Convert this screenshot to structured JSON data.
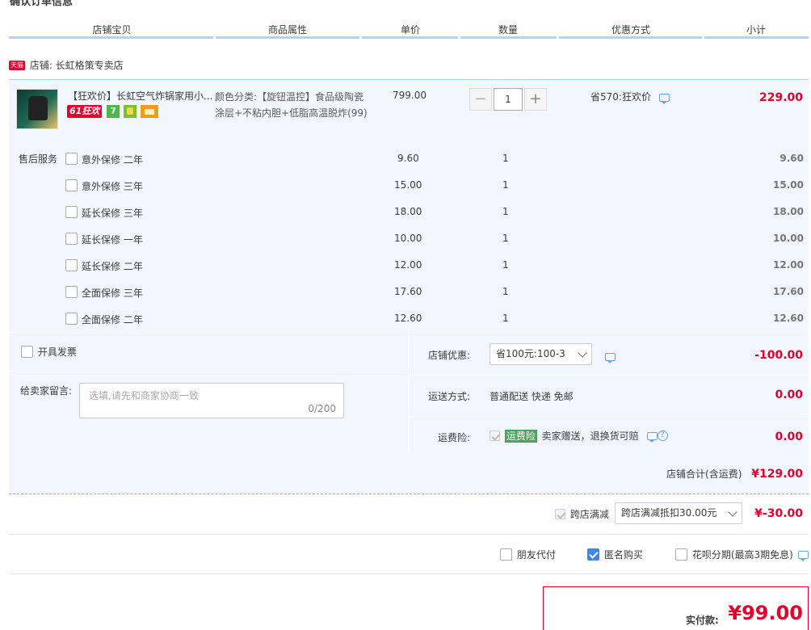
{
  "section_title": "确认订单信息",
  "columns": [
    "店铺宝贝",
    "商品属性",
    "单价",
    "数量",
    "优惠方式",
    "小计"
  ],
  "shop": {
    "badge": "天猫",
    "label": "店铺: 长虹格策专卖店"
  },
  "product": {
    "title": "【狂欢价】长虹空气炸锅家用小...",
    "promo_badge": "61狂欢",
    "attrs": "颜色分类:【旋钮温控】食品级陶瓷涂层+不粘内胆+低脂高温脱炸(99)",
    "price": "799.00",
    "qty": "1",
    "discount": "省570:狂欢价",
    "subtotal": "229.00"
  },
  "after_sales_label": "售后服务",
  "services": [
    {
      "name": "意外保修 二年",
      "price": "9.60",
      "qty": "1",
      "subtotal": "9.60"
    },
    {
      "name": "意外保修 三年",
      "price": "15.00",
      "qty": "1",
      "subtotal": "15.00"
    },
    {
      "name": "延长保修 三年",
      "price": "18.00",
      "qty": "1",
      "subtotal": "18.00"
    },
    {
      "name": "延长保修 一年",
      "price": "10.00",
      "qty": "1",
      "subtotal": "10.00"
    },
    {
      "name": "延长保修 二年",
      "price": "12.00",
      "qty": "1",
      "subtotal": "12.00"
    },
    {
      "name": "全面保修 三年",
      "price": "17.60",
      "qty": "1",
      "subtotal": "17.60"
    },
    {
      "name": "全面保修 二年",
      "price": "12.60",
      "qty": "1",
      "subtotal": "12.60"
    }
  ],
  "invoice_label": "开具发票",
  "memo": {
    "label": "给卖家留言:",
    "placeholder": "选填,请先和商家协商一致",
    "counter": "0/200"
  },
  "store_discount": {
    "label": "店铺优惠:",
    "value": "省100元:100-3",
    "amount": "-100.00"
  },
  "shipping": {
    "label": "运送方式:",
    "value": "普通配送 快递 免邮",
    "amount": "0.00"
  },
  "freight_insurance": {
    "label": "运费险:",
    "tag": "运费险",
    "text": "卖家赠送，退换货可赔",
    "amount": "0.00"
  },
  "store_total": {
    "label": "店铺合计(含运费)",
    "amount": "¥129.00"
  },
  "cross_store": {
    "label": "跨店满减",
    "value": "跨店满减抵扣30.00元",
    "amount": "¥-30.00"
  },
  "options": {
    "friend_pay": "朋友代付",
    "anonymous": "匿名购买",
    "huabei": "花呗分期(最高3期免息)"
  },
  "final": {
    "label": "实付款:",
    "amount": "¥99.00"
  },
  "colors": {
    "accent": "#e4002b",
    "header_line": "#b2d1ff",
    "row_bg": "#f2f7ff"
  }
}
